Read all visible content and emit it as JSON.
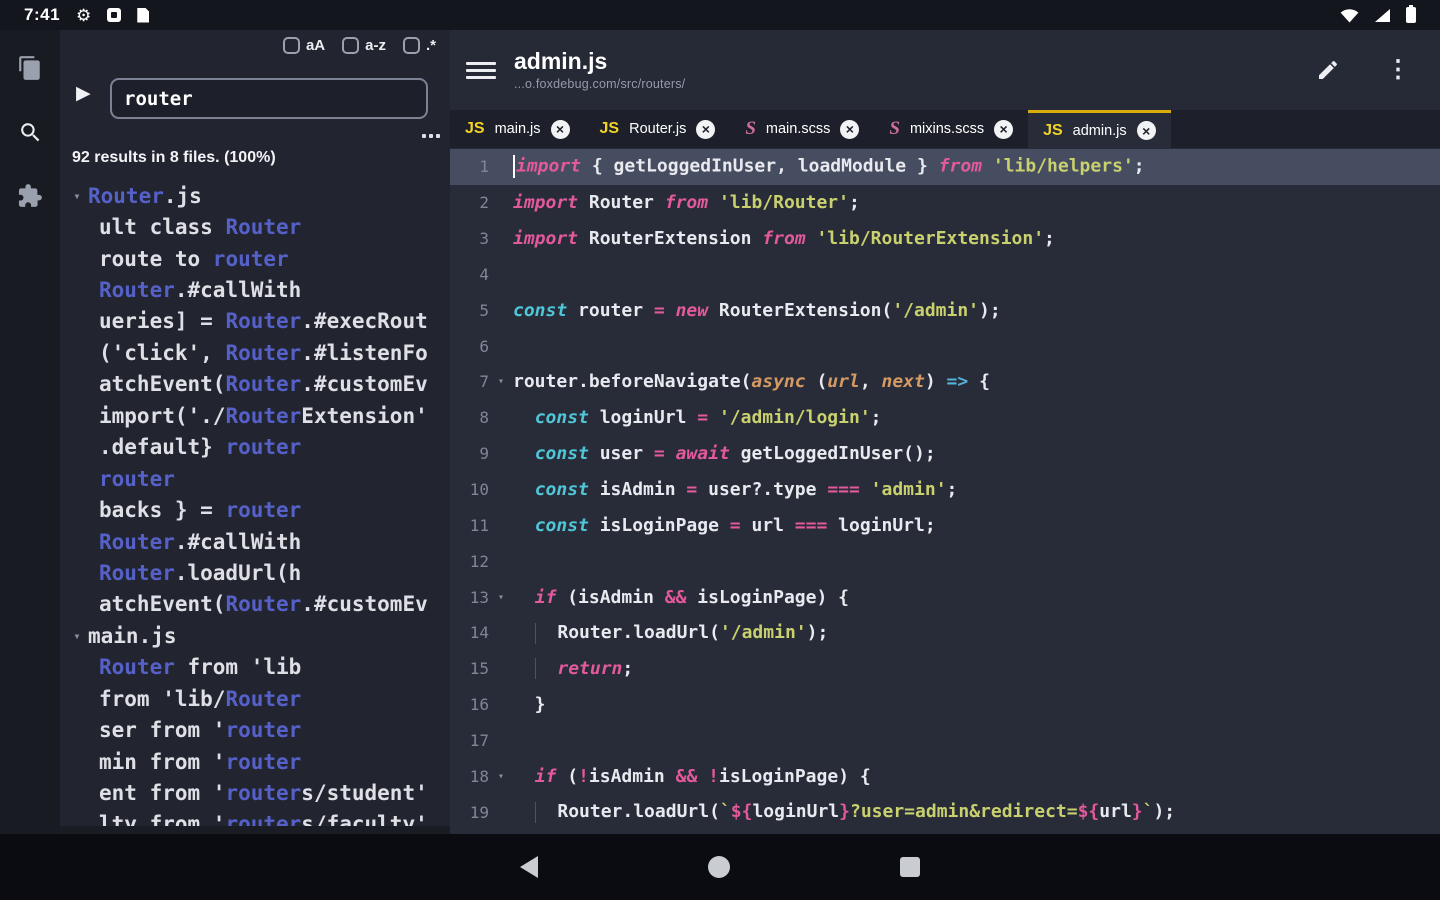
{
  "status_bar": {
    "time": "7:41"
  },
  "icons": {
    "gear": "⚙",
    "play": "▶",
    "caret_down": "▾",
    "fold_arrow": "▾",
    "close": "×",
    "kebab": "⋮",
    "js_badge": "JS",
    "sass_badge": "S",
    "named_shapes": [
      "wifi-icon",
      "signal-icon",
      "battery-icon",
      "square-app-icon",
      "file-notification-icon",
      "files-icon",
      "search-icon",
      "extensions-icon",
      "hamburger-icon",
      "pencil-icon",
      "more-options-icon",
      "back-icon",
      "home-icon",
      "recents-icon",
      "text-cursor"
    ]
  },
  "search_panel": {
    "options": [
      {
        "label": "aA"
      },
      {
        "label": "a-z"
      },
      {
        "label": ".*"
      }
    ],
    "query": "router",
    "summary": "92 results in 8 files. (100%)",
    "results": [
      {
        "file": 1,
        "segs": [
          [
            "Router",
            1
          ],
          [
            ".js",
            0
          ]
        ]
      },
      {
        "segs": [
          [
            "ult class ",
            0
          ],
          [
            "Router",
            1
          ]
        ]
      },
      {
        "segs": [
          [
            "route to ",
            0
          ],
          [
            "router",
            1
          ]
        ]
      },
      {
        "segs": [
          [
            "Router",
            1
          ],
          [
            ".#callWith",
            0
          ]
        ]
      },
      {
        "segs": [
          [
            "ueries] = ",
            0
          ],
          [
            "Router",
            1
          ],
          [
            ".#execRout",
            0
          ]
        ]
      },
      {
        "segs": [
          [
            "('click', ",
            0
          ],
          [
            "Router",
            1
          ],
          [
            ".#listenFo",
            0
          ]
        ]
      },
      {
        "segs": [
          [
            "atchEvent(",
            0
          ],
          [
            "Router",
            1
          ],
          [
            ".#customEv",
            0
          ]
        ]
      },
      {
        "segs": [
          [
            "import('./",
            0
          ],
          [
            "Router",
            1
          ],
          [
            "Extension'",
            0
          ]
        ]
      },
      {
        "segs": [
          [
            ".default} ",
            0
          ],
          [
            "router",
            1
          ]
        ]
      },
      {
        "segs": [
          [
            "router",
            1
          ]
        ]
      },
      {
        "segs": [
          [
            "backs } = ",
            0
          ],
          [
            "router",
            1
          ]
        ]
      },
      {
        "segs": [
          [
            "Router",
            1
          ],
          [
            ".#callWith",
            0
          ]
        ]
      },
      {
        "segs": [
          [
            "Router",
            1
          ],
          [
            ".loadUrl(h",
            0
          ]
        ]
      },
      {
        "segs": [
          [
            "atchEvent(",
            0
          ],
          [
            "Router",
            1
          ],
          [
            ".#customEv",
            0
          ]
        ]
      },
      {
        "file": 1,
        "segs": [
          [
            "main.js",
            0
          ]
        ]
      },
      {
        "segs": [
          [
            "Router",
            1
          ],
          [
            " from 'lib",
            0
          ]
        ]
      },
      {
        "segs": [
          [
            "from 'lib/",
            0
          ],
          [
            "Router",
            1
          ]
        ]
      },
      {
        "segs": [
          [
            "ser from '",
            0
          ],
          [
            "router",
            1
          ]
        ]
      },
      {
        "segs": [
          [
            "min from '",
            0
          ],
          [
            "router",
            1
          ]
        ]
      },
      {
        "segs": [
          [
            "ent from '",
            0
          ],
          [
            "router",
            1
          ],
          [
            "s/student'",
            0
          ]
        ]
      },
      {
        "segs": [
          [
            "lty from '",
            0
          ],
          [
            "router",
            1
          ],
          [
            "s/faculty'",
            0
          ]
        ]
      }
    ]
  },
  "header": {
    "title": "admin.js",
    "subtitle": "...o.foxdebug.com/src/routers/"
  },
  "tabs": [
    {
      "icon": "js",
      "label": "main.js"
    },
    {
      "icon": "js",
      "label": "Router.js"
    },
    {
      "icon": "sass",
      "label": "main.scss"
    },
    {
      "icon": "sass",
      "label": "mixins.scss"
    },
    {
      "icon": "js",
      "label": "admin.js",
      "active": true
    }
  ],
  "editor": {
    "lines": [
      {
        "n": 1,
        "active": true,
        "cursor": true,
        "toks": [
          [
            "import",
            "kw"
          ],
          [
            " { getLoggedInUser, loadModule } ",
            "pl"
          ],
          [
            "from",
            "kw"
          ],
          [
            " ",
            "pl"
          ],
          [
            "'lib/helpers'",
            "str"
          ],
          [
            ";",
            "pl"
          ]
        ]
      },
      {
        "n": 2,
        "toks": [
          [
            "import",
            "kw"
          ],
          [
            " Router ",
            "pl"
          ],
          [
            "from",
            "kw"
          ],
          [
            " ",
            "pl"
          ],
          [
            "'lib/Router'",
            "str"
          ],
          [
            ";",
            "pl"
          ]
        ]
      },
      {
        "n": 3,
        "toks": [
          [
            "import",
            "kw"
          ],
          [
            " RouterExtension ",
            "pl"
          ],
          [
            "from",
            "kw"
          ],
          [
            " ",
            "pl"
          ],
          [
            "'lib/RouterExtension'",
            "str"
          ],
          [
            ";",
            "pl"
          ]
        ]
      },
      {
        "n": 4,
        "toks": []
      },
      {
        "n": 5,
        "toks": [
          [
            "const",
            "cst"
          ],
          [
            " router ",
            "pl"
          ],
          [
            "=",
            "op"
          ],
          [
            " ",
            "pl"
          ],
          [
            "new",
            "kw"
          ],
          [
            " RouterExtension(",
            "pl"
          ],
          [
            "'/admin'",
            "str"
          ],
          [
            ");",
            "pl"
          ]
        ]
      },
      {
        "n": 6,
        "toks": []
      },
      {
        "n": 7,
        "fold": true,
        "toks": [
          [
            "router.beforeNavigate(",
            "pl"
          ],
          [
            "async",
            "par"
          ],
          [
            " (",
            "pl"
          ],
          [
            "url",
            "par"
          ],
          [
            ", ",
            "pl"
          ],
          [
            "next",
            "par"
          ],
          [
            ") ",
            "pl"
          ],
          [
            "=>",
            "arw"
          ],
          [
            " {",
            "pl"
          ]
        ]
      },
      {
        "n": 8,
        "toks": [
          [
            "  ",
            "pl"
          ],
          [
            "const",
            "cst"
          ],
          [
            " loginUrl ",
            "pl"
          ],
          [
            "=",
            "op"
          ],
          [
            " ",
            "pl"
          ],
          [
            "'/admin/login'",
            "str"
          ],
          [
            ";",
            "pl"
          ]
        ]
      },
      {
        "n": 9,
        "toks": [
          [
            "  ",
            "pl"
          ],
          [
            "const",
            "cst"
          ],
          [
            " user ",
            "pl"
          ],
          [
            "=",
            "op"
          ],
          [
            " ",
            "pl"
          ],
          [
            "await",
            "kwi"
          ],
          [
            " getLoggedInUser();",
            "pl"
          ]
        ]
      },
      {
        "n": 10,
        "toks": [
          [
            "  ",
            "pl"
          ],
          [
            "const",
            "cst"
          ],
          [
            " isAdmin ",
            "pl"
          ],
          [
            "=",
            "op"
          ],
          [
            " user?.type ",
            "pl"
          ],
          [
            "===",
            "op"
          ],
          [
            " ",
            "pl"
          ],
          [
            "'admin'",
            "str"
          ],
          [
            ";",
            "pl"
          ]
        ]
      },
      {
        "n": 11,
        "toks": [
          [
            "  ",
            "pl"
          ],
          [
            "const",
            "cst"
          ],
          [
            " isLoginPage ",
            "pl"
          ],
          [
            "=",
            "op"
          ],
          [
            " url ",
            "pl"
          ],
          [
            "===",
            "op"
          ],
          [
            " loginUrl;",
            "pl"
          ]
        ]
      },
      {
        "n": 12,
        "toks": []
      },
      {
        "n": 13,
        "fold": true,
        "toks": [
          [
            "  ",
            "pl"
          ],
          [
            "if",
            "kw"
          ],
          [
            " (isAdmin ",
            "pl"
          ],
          [
            "&&",
            "op"
          ],
          [
            " isLoginPage) {",
            "pl"
          ]
        ]
      },
      {
        "n": 14,
        "toks": [
          [
            "  ",
            "pl"
          ],
          [
            "",
            "gd"
          ],
          [
            "  Router.loadUrl(",
            "pl"
          ],
          [
            "'/admin'",
            "str"
          ],
          [
            ");",
            "pl"
          ]
        ]
      },
      {
        "n": 15,
        "toks": [
          [
            "  ",
            "pl"
          ],
          [
            "",
            "gd"
          ],
          [
            "  ",
            "pl"
          ],
          [
            "return",
            "kw"
          ],
          [
            ";",
            "pl"
          ]
        ]
      },
      {
        "n": 16,
        "toks": [
          [
            "  }",
            "pl"
          ]
        ]
      },
      {
        "n": 17,
        "toks": []
      },
      {
        "n": 18,
        "fold": true,
        "toks": [
          [
            "  ",
            "pl"
          ],
          [
            "if",
            "kw"
          ],
          [
            " (",
            "pl"
          ],
          [
            "!",
            "op"
          ],
          [
            "isAdmin ",
            "pl"
          ],
          [
            "&&",
            "op"
          ],
          [
            " ",
            "pl"
          ],
          [
            "!",
            "op"
          ],
          [
            "isLoginPage) {",
            "pl"
          ]
        ]
      },
      {
        "n": 19,
        "toks": [
          [
            "  ",
            "pl"
          ],
          [
            "",
            "gd"
          ],
          [
            "  Router.loadUrl(",
            "pl"
          ],
          [
            "`",
            "str"
          ],
          [
            "${",
            "tpl"
          ],
          [
            "loginUrl",
            "pl"
          ],
          [
            "}",
            "tpl"
          ],
          [
            "?user=admin&redirect=",
            "str"
          ],
          [
            "${",
            "tpl"
          ],
          [
            "url",
            "pl"
          ],
          [
            "}",
            "tpl"
          ],
          [
            "`",
            "str"
          ],
          [
            ");",
            "pl"
          ]
        ]
      }
    ]
  }
}
